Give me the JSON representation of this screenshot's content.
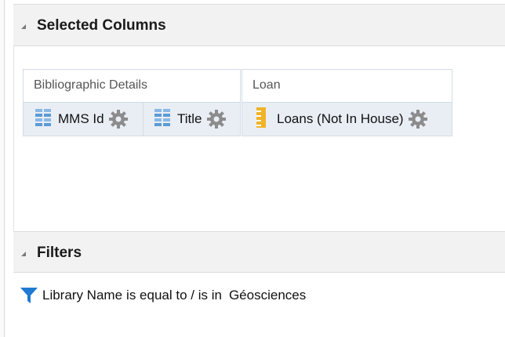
{
  "selected_columns": {
    "title": "Selected Columns",
    "groups": [
      {
        "label": "Bibliographic Details",
        "columns": [
          {
            "label": "MMS Id",
            "icon": "attribute-grid-icon"
          },
          {
            "label": "Title",
            "icon": "attribute-grid-icon"
          }
        ]
      },
      {
        "label": "Loan",
        "columns": [
          {
            "label": "Loans (Not In House)",
            "icon": "measure-ruler-icon"
          }
        ]
      }
    ]
  },
  "filters": {
    "title": "Filters",
    "items": [
      {
        "field": "Library Name",
        "operator": "is equal to / is in",
        "value": "Géosciences"
      }
    ]
  },
  "colors": {
    "attribute_icon": "#5b9bd5",
    "measure_icon": "#f0b429",
    "filter_icon": "#1f7ad1",
    "gear": "#8c8c8c"
  }
}
